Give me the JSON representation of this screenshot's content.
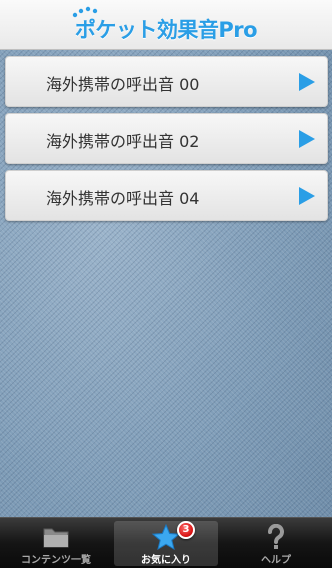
{
  "header": {
    "title": "ポケット効果音Pro"
  },
  "list": {
    "items": [
      {
        "label": "海外携帯の呼出音 00"
      },
      {
        "label": "海外携帯の呼出音 02"
      },
      {
        "label": "海外携帯の呼出音 04"
      }
    ],
    "action_icon": "play-icon"
  },
  "tabbar": {
    "tabs": [
      {
        "label": "コンテンツ一覧",
        "icon": "folder-icon",
        "selected": false
      },
      {
        "label": "お気に入り",
        "icon": "star-icon",
        "selected": true,
        "badge": "3"
      },
      {
        "label": "ヘルプ",
        "icon": "question-mark-icon",
        "selected": false
      }
    ]
  },
  "colors": {
    "brand": "#2a9ee6",
    "play": "#2a9ee6",
    "badge": "#d40f0f"
  }
}
